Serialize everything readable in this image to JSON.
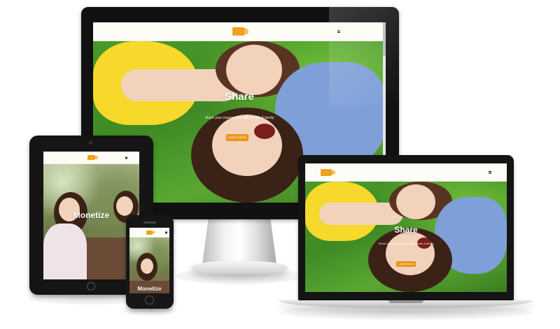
{
  "hero": {
    "monitor_title": "Share",
    "monitor_subtitle": "Share your experiences with friends & family",
    "laptop_title": "Share",
    "laptop_subtitle": "Share your experiences with friends & family",
    "button_label": "LEARN MORE",
    "tablet_title": "Monetize",
    "phone_title": "Monetize"
  },
  "icons": {
    "logo": "megaphone-logo",
    "menu": "hamburger-menu-icon"
  },
  "colors": {
    "accent": "#e8961c",
    "logo": "#f0a020",
    "header_bg": "#fdfcf6",
    "device_frame": "#141414"
  }
}
